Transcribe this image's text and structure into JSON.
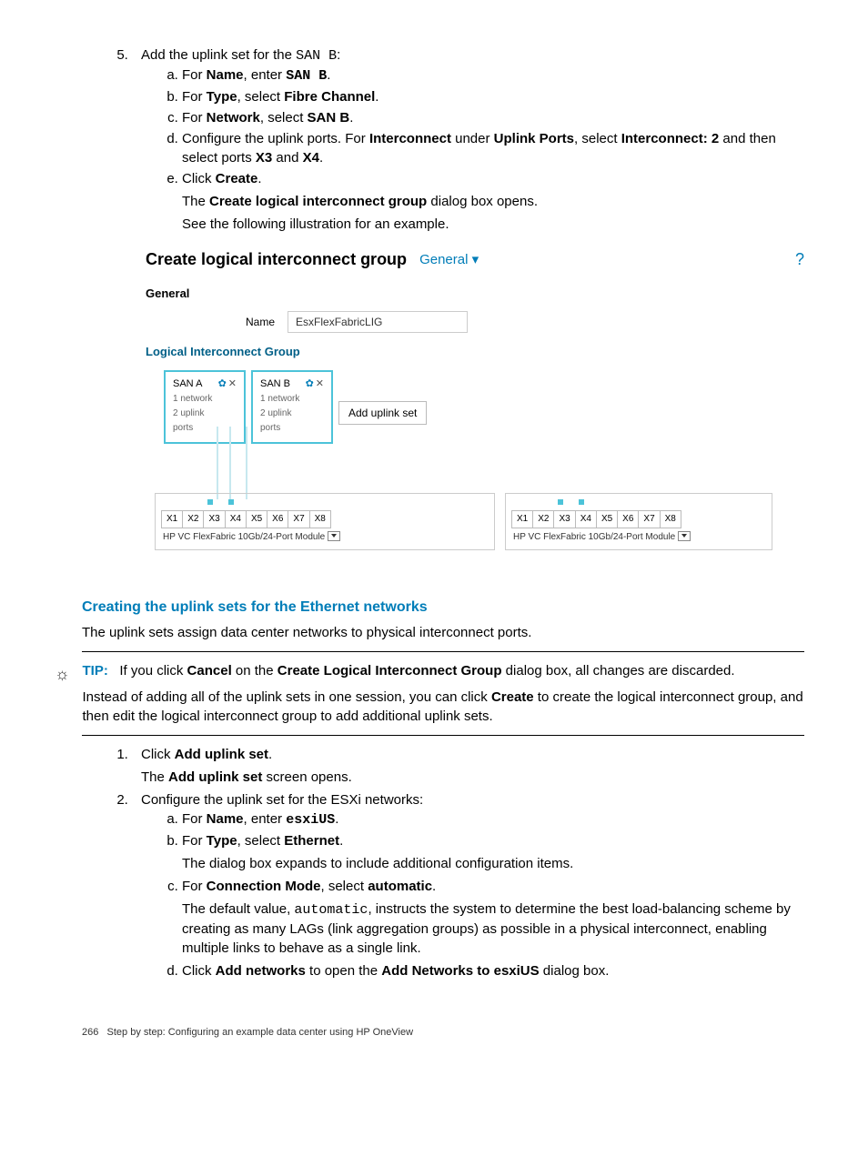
{
  "step5": {
    "num": "5.",
    "intro_a": "Add the uplink set for the ",
    "intro_code": "SAN B",
    "intro_b": ":",
    "a": {
      "pre": "For ",
      "b1": "Name",
      "mid": ", enter ",
      "b2": "SAN B",
      "post": "."
    },
    "b": {
      "pre": "For ",
      "b1": "Type",
      "mid": ", select ",
      "b2": "Fibre Channel",
      "post": "."
    },
    "c": {
      "pre": "For ",
      "b1": "Network",
      "mid": ", select ",
      "b2": "SAN B",
      "post": "."
    },
    "d": {
      "pre": "Configure the uplink ports. For ",
      "b1": "Interconnect",
      "mid": " under ",
      "b2": "Uplink Ports",
      "mid2": ", select ",
      "b3": "Interconnect: 2",
      "mid3": " and then select ports ",
      "b4": "X3",
      "mid4": " and ",
      "b5": "X4",
      "post": "."
    },
    "e": {
      "pre": "Click ",
      "b1": "Create",
      "post": "."
    },
    "e_p1_a": "The ",
    "e_p1_b": "Create logical interconnect group",
    "e_p1_c": " dialog box opens.",
    "e_p2": "See the following illustration for an example."
  },
  "figure": {
    "title": "Create logical interconnect group",
    "dropdown": "General ",
    "help": "?",
    "general_heading": "General",
    "name_label": "Name",
    "name_value": "EsxFlexFabricLIG",
    "lig_heading": "Logical Interconnect Group",
    "san_a": {
      "title": "SAN A",
      "meta1": "1 network",
      "meta2": "2 uplink",
      "meta3": "ports"
    },
    "san_b": {
      "title": "SAN B",
      "meta1": "1 network",
      "meta2": "2 uplink",
      "meta3": "ports"
    },
    "add_btn": "Add uplink set",
    "ports": [
      "X1",
      "X2",
      "X3",
      "X4",
      "X5",
      "X6",
      "X7",
      "X8"
    ],
    "module_label": "HP VC FlexFabric 10Gb/24-Port Module"
  },
  "section2": {
    "heading": "Creating the uplink sets for the Ethernet networks",
    "intro": "The uplink sets assign data center networks to physical interconnect ports.",
    "tip_label": "TIP:",
    "tip_p1_a": "If you click ",
    "tip_p1_b": "Cancel",
    "tip_p1_c": " on the ",
    "tip_p1_d": "Create Logical Interconnect Group",
    "tip_p1_e": " dialog box, all changes are discarded.",
    "tip_p2_a": "Instead of adding all of the uplink sets in one session, you can click ",
    "tip_p2_b": "Create",
    "tip_p2_c": " to create the logical interconnect group, and then edit the logical interconnect group to add additional uplink sets.",
    "s1": {
      "pre": "Click ",
      "b1": "Add uplink set",
      "post": ".",
      "p1_a": "The ",
      "p1_b": "Add uplink set",
      "p1_c": " screen opens."
    },
    "s2": {
      "text": "Configure the uplink set for the ESXi networks:"
    },
    "s2a": {
      "pre": "For ",
      "b1": "Name",
      "mid": ", enter ",
      "code": "esxiUS",
      "post": "."
    },
    "s2b": {
      "pre": "For ",
      "b1": "Type",
      "mid": ", select ",
      "b2": "Ethernet",
      "post": ".",
      "p1": "The dialog box expands to include additional configuration items."
    },
    "s2c": {
      "pre": "For ",
      "b1": "Connection Mode",
      "mid": ", select ",
      "b2": "automatic",
      "post": ".",
      "p1_a": "The default value, ",
      "p1_code": "automatic",
      "p1_b": ", instructs the system to determine the best load-balancing scheme by creating as many LAGs (link aggregation groups) as possible in a physical interconnect, enabling multiple links to behave as a single link."
    },
    "s2d": {
      "pre": "Click ",
      "b1": "Add networks",
      "mid": " to open the ",
      "b2": "Add Networks to esxiUS",
      "post": " dialog box."
    }
  },
  "footer": {
    "page": "266",
    "text": "Step by step: Configuring an example data center using HP OneView"
  }
}
